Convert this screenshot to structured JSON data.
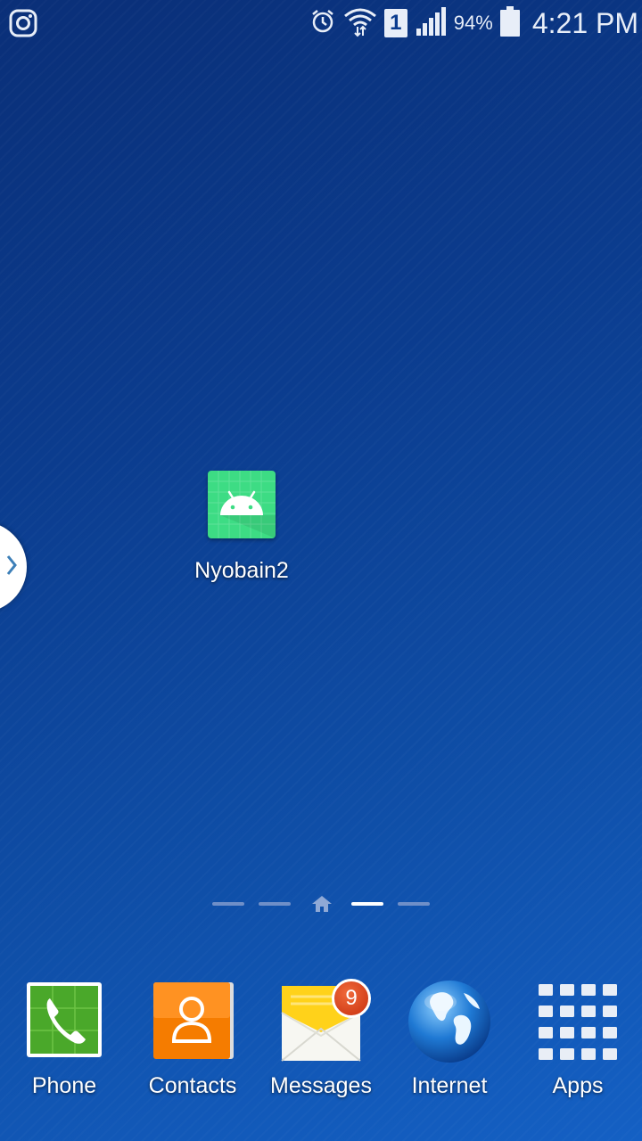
{
  "status_bar": {
    "left_icons": [
      "instagram-icon"
    ],
    "right_icons": [
      "alarm-icon",
      "wifi-icon",
      "sim-1-icon",
      "signal-icon",
      "battery-icon"
    ],
    "sim_number": "1",
    "battery_percent": "94%",
    "time": "4:21 PM"
  },
  "home_screen": {
    "apps": [
      {
        "label": "Nyobain2",
        "icon": "android-app-icon"
      }
    ],
    "page_indicator": {
      "pages": 5,
      "home_page_index": 2,
      "active_page_index": 3
    }
  },
  "dock": {
    "items": [
      {
        "label": "Phone",
        "icon": "phone-icon"
      },
      {
        "label": "Contacts",
        "icon": "contacts-icon"
      },
      {
        "label": "Messages",
        "icon": "messages-icon",
        "badge": "9"
      },
      {
        "label": "Internet",
        "icon": "globe-icon"
      },
      {
        "label": "Apps",
        "icon": "apps-grid-icon"
      }
    ]
  },
  "colors": {
    "wallpaper_top": "#0a2f78",
    "wallpaper_bottom": "#1460c4",
    "android_green": "#3ddc84",
    "badge_red": "#d8401a"
  }
}
